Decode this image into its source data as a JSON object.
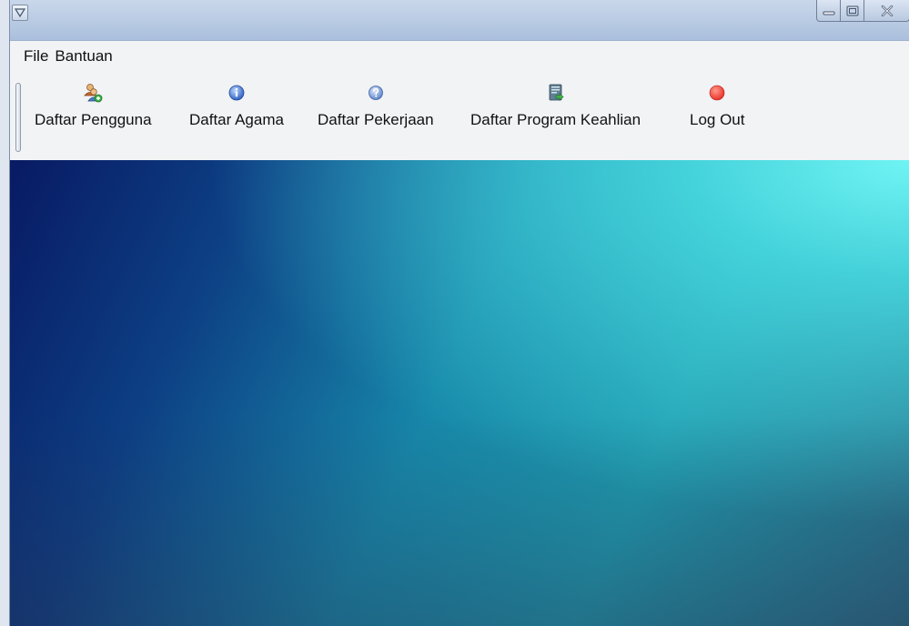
{
  "window": {
    "controls": {
      "system_menu_icon": "triangle-down-icon",
      "minimize_icon": "minimize-icon",
      "maximize_icon": "maximize-icon",
      "close_icon": "close-icon"
    }
  },
  "menubar": {
    "items": [
      {
        "label": "File"
      },
      {
        "label": "Bantuan"
      }
    ]
  },
  "toolbar": {
    "items": [
      {
        "label": "Daftar Pengguna",
        "icon": "users-icon"
      },
      {
        "label": "Daftar Agama",
        "icon": "info-icon"
      },
      {
        "label": "Daftar Pekerjaan",
        "icon": "help-icon"
      },
      {
        "label": "Daftar Program Keahlian",
        "icon": "document-arrow-icon"
      },
      {
        "label": "Log Out",
        "icon": "red-circle-icon"
      }
    ]
  },
  "colors": {
    "titlebar": "#b7c9e2",
    "desktop_dark": "#081a63",
    "desktop_light": "#6ff4f4",
    "logout_red": "#e8322a"
  }
}
